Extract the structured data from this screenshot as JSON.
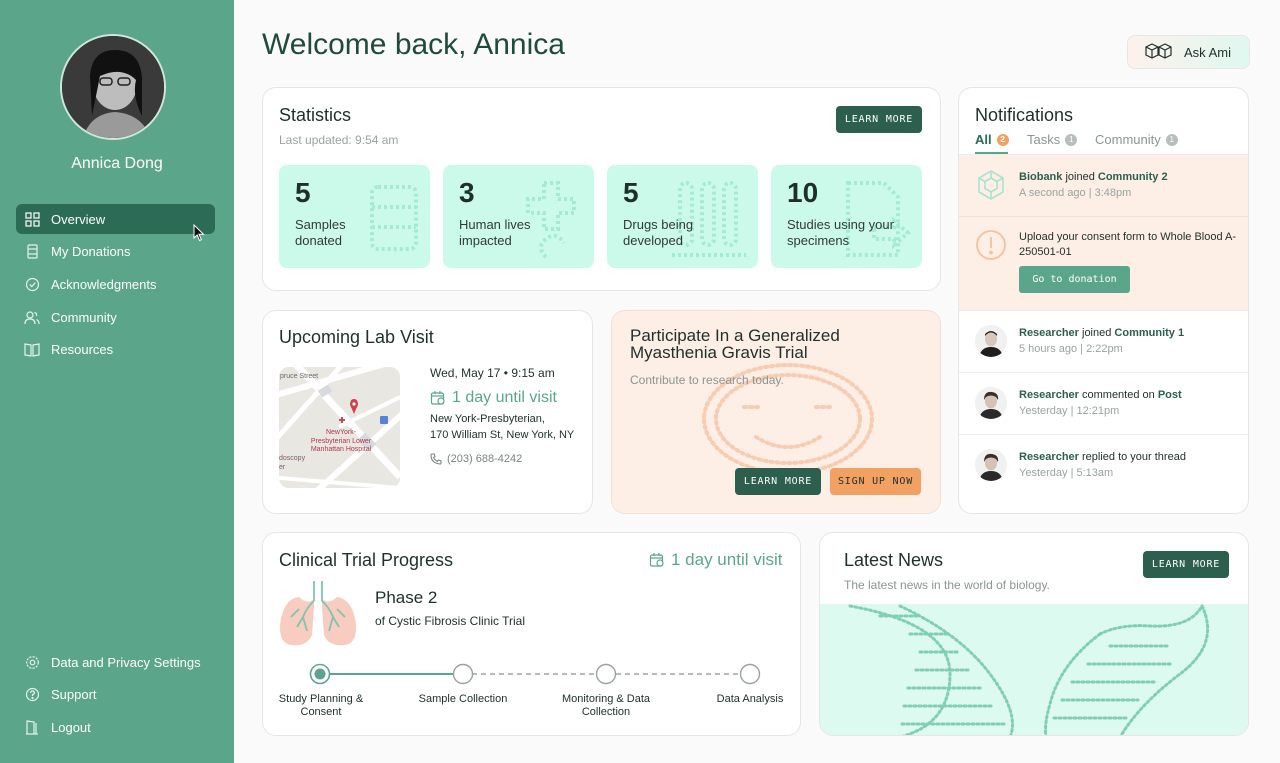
{
  "user": {
    "name": "Annica Dong"
  },
  "nav": {
    "items": [
      {
        "label": "Overview",
        "icon": "grid-icon",
        "active": true
      },
      {
        "label": "My Donations",
        "icon": "tube-icon"
      },
      {
        "label": "Acknowledgments",
        "icon": "check-circle-icon"
      },
      {
        "label": "Community",
        "icon": "users-icon"
      },
      {
        "label": "Resources",
        "icon": "book-icon"
      }
    ],
    "bottom": [
      {
        "label": "Data and Privacy Settings",
        "icon": "gear-icon"
      },
      {
        "label": "Support",
        "icon": "help-icon"
      },
      {
        "label": "Logout",
        "icon": "logout-icon"
      }
    ]
  },
  "header": {
    "welcome": "Welcome back, Annica",
    "ask_ami": "Ask Ami"
  },
  "statistics": {
    "title": "Statistics",
    "updated": "Last updated: 9:54 am",
    "learn_more": "LEARN MORE",
    "cards": [
      {
        "value": "5",
        "label": "Samples donated"
      },
      {
        "value": "3",
        "label": "Human lives impacted"
      },
      {
        "value": "5",
        "label": "Drugs being developed"
      },
      {
        "value": "10",
        "label": "Studies using your specimens"
      }
    ]
  },
  "lab_visit": {
    "title": "Upcoming Lab Visit",
    "datetime": "Wed, May 17 • 9:15 am",
    "countdown": "1 day until visit",
    "location_name": "New York-Presbyterian,",
    "address": "170 William St, New York, NY",
    "phone": "(203) 688-4242",
    "map": {
      "street": "pruce Street",
      "hospital": "NewYork-Presbyterian Lower Manhattan Hospital",
      "poi": "doscopy er"
    }
  },
  "trial_promo": {
    "title": "Participate In a Generalized Myasthenia Gravis Trial",
    "subtitle": "Contribute to research today.",
    "learn_more": "LEARN MORE",
    "sign_up": "SIGN UP NOW"
  },
  "notifications": {
    "title": "Notifications",
    "tabs": [
      {
        "label": "All",
        "count": "2",
        "active": true
      },
      {
        "label": "Tasks",
        "count": "1"
      },
      {
        "label": "Community",
        "count": "1"
      }
    ],
    "items": [
      {
        "actor": "Biobank",
        "action": " joined ",
        "target": "Community 2",
        "time": "A second ago | 3:48pm"
      },
      {
        "text": "Upload your consent form to Whole Blood A-250501-01",
        "button": "Go to donation"
      },
      {
        "actor": "Researcher",
        "action": " joined ",
        "target": "Community 1",
        "time": "5 hours ago | 2:22pm"
      },
      {
        "actor": "Researcher",
        "action": " commented on ",
        "target": "Post",
        "time": "Yesterday | 12:21pm"
      },
      {
        "actor": "Researcher",
        "action": " replied to your thread",
        "target": "",
        "time": "Yesterday | 5:13am"
      }
    ]
  },
  "clinical_trial": {
    "title": "Clinical Trial Progress",
    "countdown": "1 day until visit",
    "phase": "Phase 2",
    "trial_name": "of Cystic Fibrosis Clinic Trial",
    "steps": [
      "Study Planning & Consent",
      "Sample Collection",
      "Monitoring & Data Collection",
      "Data Analysis"
    ],
    "current_step": 1
  },
  "news": {
    "title": "Latest News",
    "subtitle": "The latest news in the world of biology.",
    "learn_more": "LEARN MORE"
  },
  "colors": {
    "sidebar": "#5ba68a",
    "accent_dark": "#2c5f4d",
    "mint": "#ccfaea",
    "peach": "#fdeee6",
    "orange": "#f2a162"
  }
}
